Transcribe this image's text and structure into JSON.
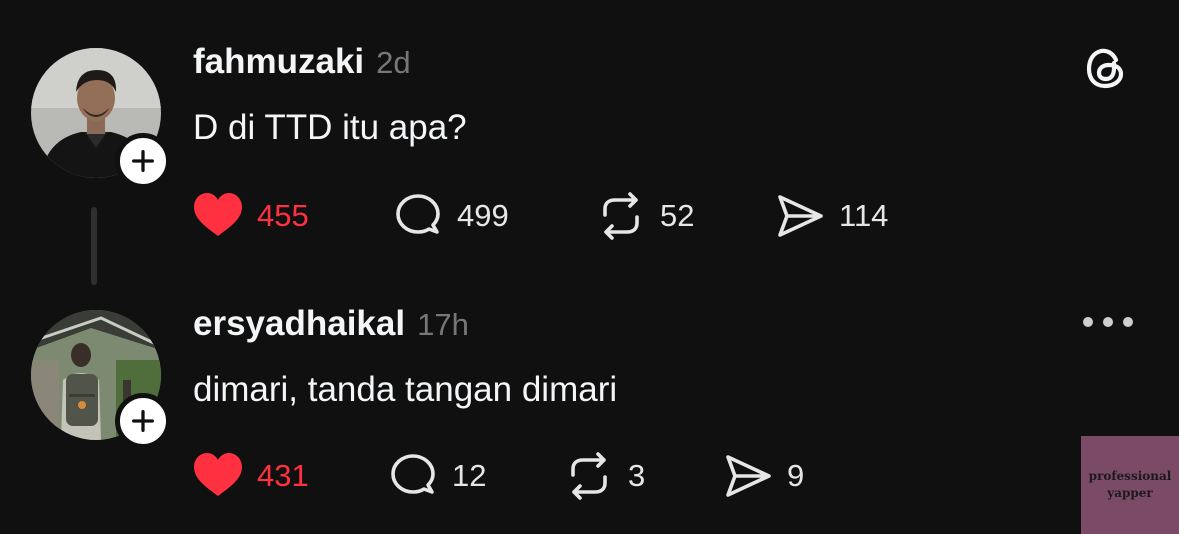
{
  "colors": {
    "background": "#101010",
    "like_red": "#ff3040",
    "text_primary": "#f3f5f7",
    "text_secondary": "#777777"
  },
  "app": {
    "logo_icon": "threads-logo-icon"
  },
  "posts": [
    {
      "username": "fahmuzaki",
      "time": "2d",
      "text": "D di TTD itu apa?",
      "avatar_icon": "avatar-man-black-shirt",
      "liked": true,
      "likes": "455",
      "replies": "499",
      "reposts": "52",
      "shares": "114"
    },
    {
      "username": "ersyadhaikal",
      "time": "17h",
      "text": "dimari, tanda tangan dimari",
      "avatar_icon": "avatar-person-backpack",
      "liked": true,
      "likes": "431",
      "replies": "12",
      "reposts": "3",
      "shares": "9"
    }
  ],
  "watermark": {
    "line1": "professional",
    "line2": "yapper"
  }
}
